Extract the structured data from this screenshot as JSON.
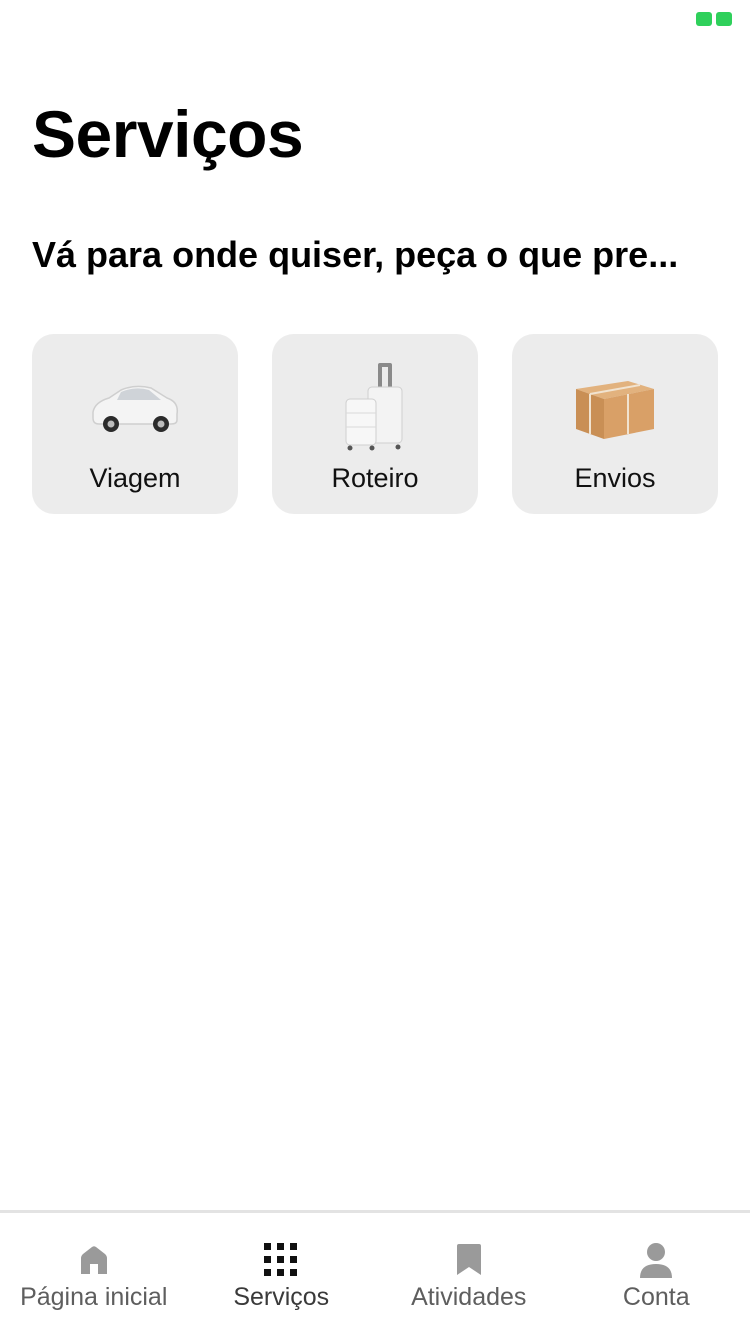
{
  "page": {
    "title": "Serviços",
    "subtitle": "Vá para onde quiser, peça o que pre..."
  },
  "tiles": [
    {
      "label": "Viagem",
      "icon": "car-icon"
    },
    {
      "label": "Roteiro",
      "icon": "luggage-icon"
    },
    {
      "label": "Envios",
      "icon": "package-icon"
    }
  ],
  "tabbar": {
    "items": [
      {
        "label": "Página inicial",
        "icon": "home-icon"
      },
      {
        "label": "Serviços",
        "icon": "grid-icon",
        "active": true
      },
      {
        "label": "Atividades",
        "icon": "bookmark-icon"
      },
      {
        "label": "Conta",
        "icon": "person-icon"
      }
    ]
  },
  "colors": {
    "status_indicator": "#2fd05b",
    "tile_bg": "#ececec",
    "tab_icon": "#9a9a9a",
    "tab_icon_active": "#111111"
  }
}
